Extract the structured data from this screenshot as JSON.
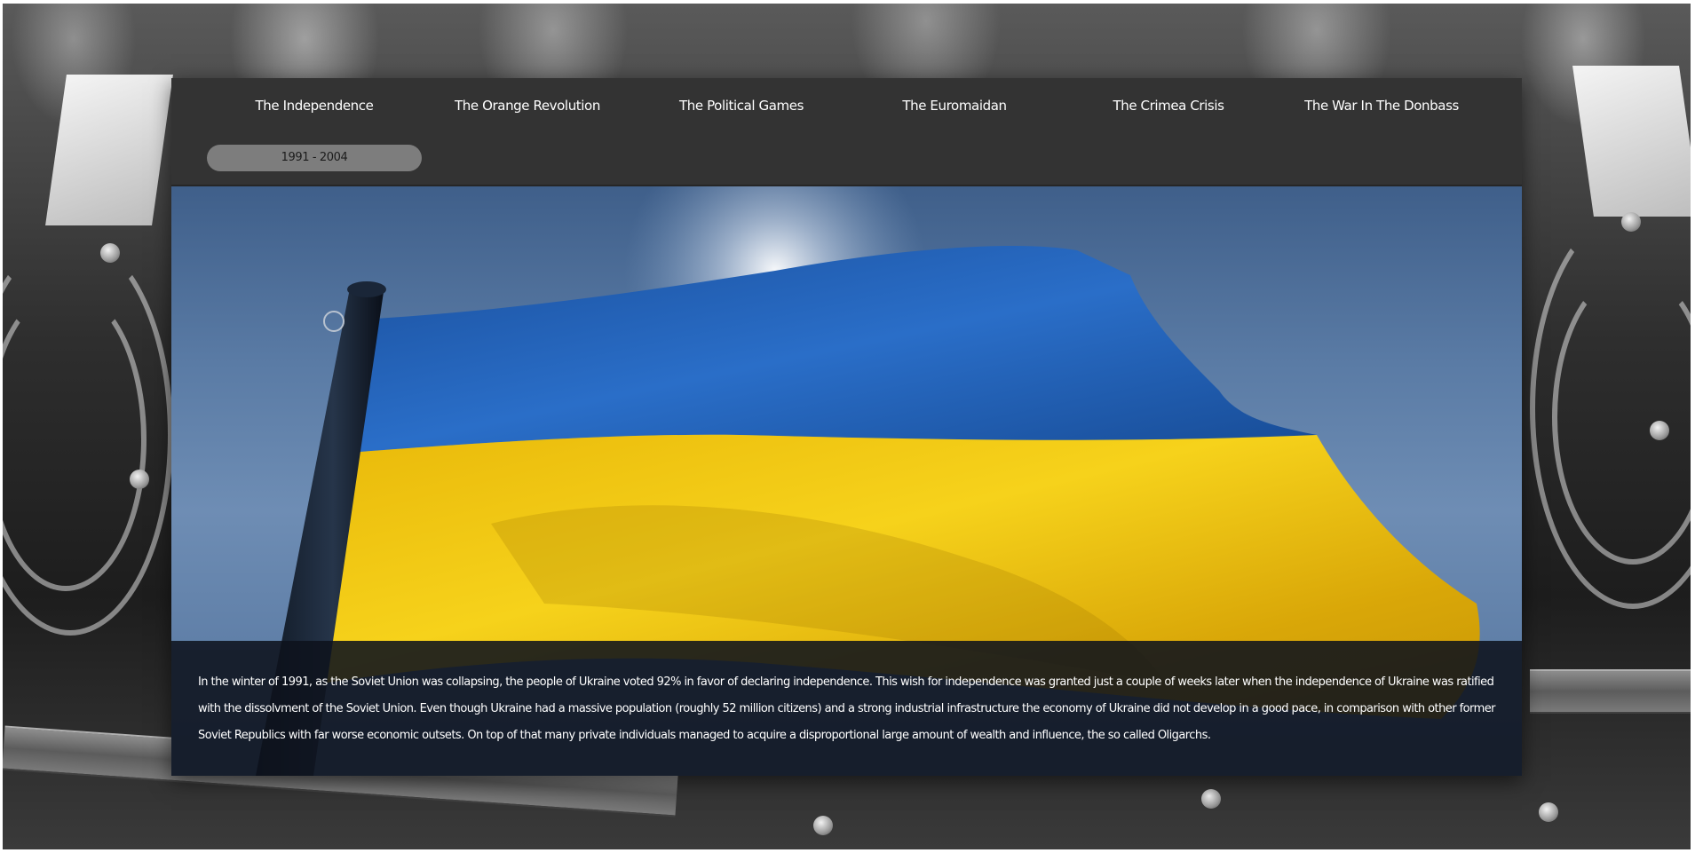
{
  "nav": {
    "items": [
      {
        "label": "The Independence"
      },
      {
        "label": "The Orange Revolution"
      },
      {
        "label": "The Political Games"
      },
      {
        "label": "The Euromaidan"
      },
      {
        "label": "The Crimea Crisis"
      },
      {
        "label": "The War In The Donbass"
      }
    ],
    "date_range": "1991 - 2004"
  },
  "hero": {
    "image": "ukrainian-flag-photo",
    "flag_colors": {
      "blue": "#1f5fb5",
      "yellow": "#f2c70d"
    }
  },
  "article": {
    "text": "In the winter of 1991, as the Soviet Union was collapsing, the people of Ukraine voted 92% in favor of declaring independence. This wish for independence was granted just a couple of weeks later when the independence of Ukraine was ratified with the dissolvment of the Soviet Union. Even though Ukraine had a massive population (roughly 52 million citizens) and a strong industrial infrastructure the economy of Ukraine did not develop in a good pace, in comparison with other former Soviet Republics with far worse economic outsets. On top of that many private individuals managed to acquire a disproportional large amount of wealth and influence, the so called Oligarchs."
  },
  "background": {
    "image": "soldiers-uniform-photo-grayscale"
  }
}
